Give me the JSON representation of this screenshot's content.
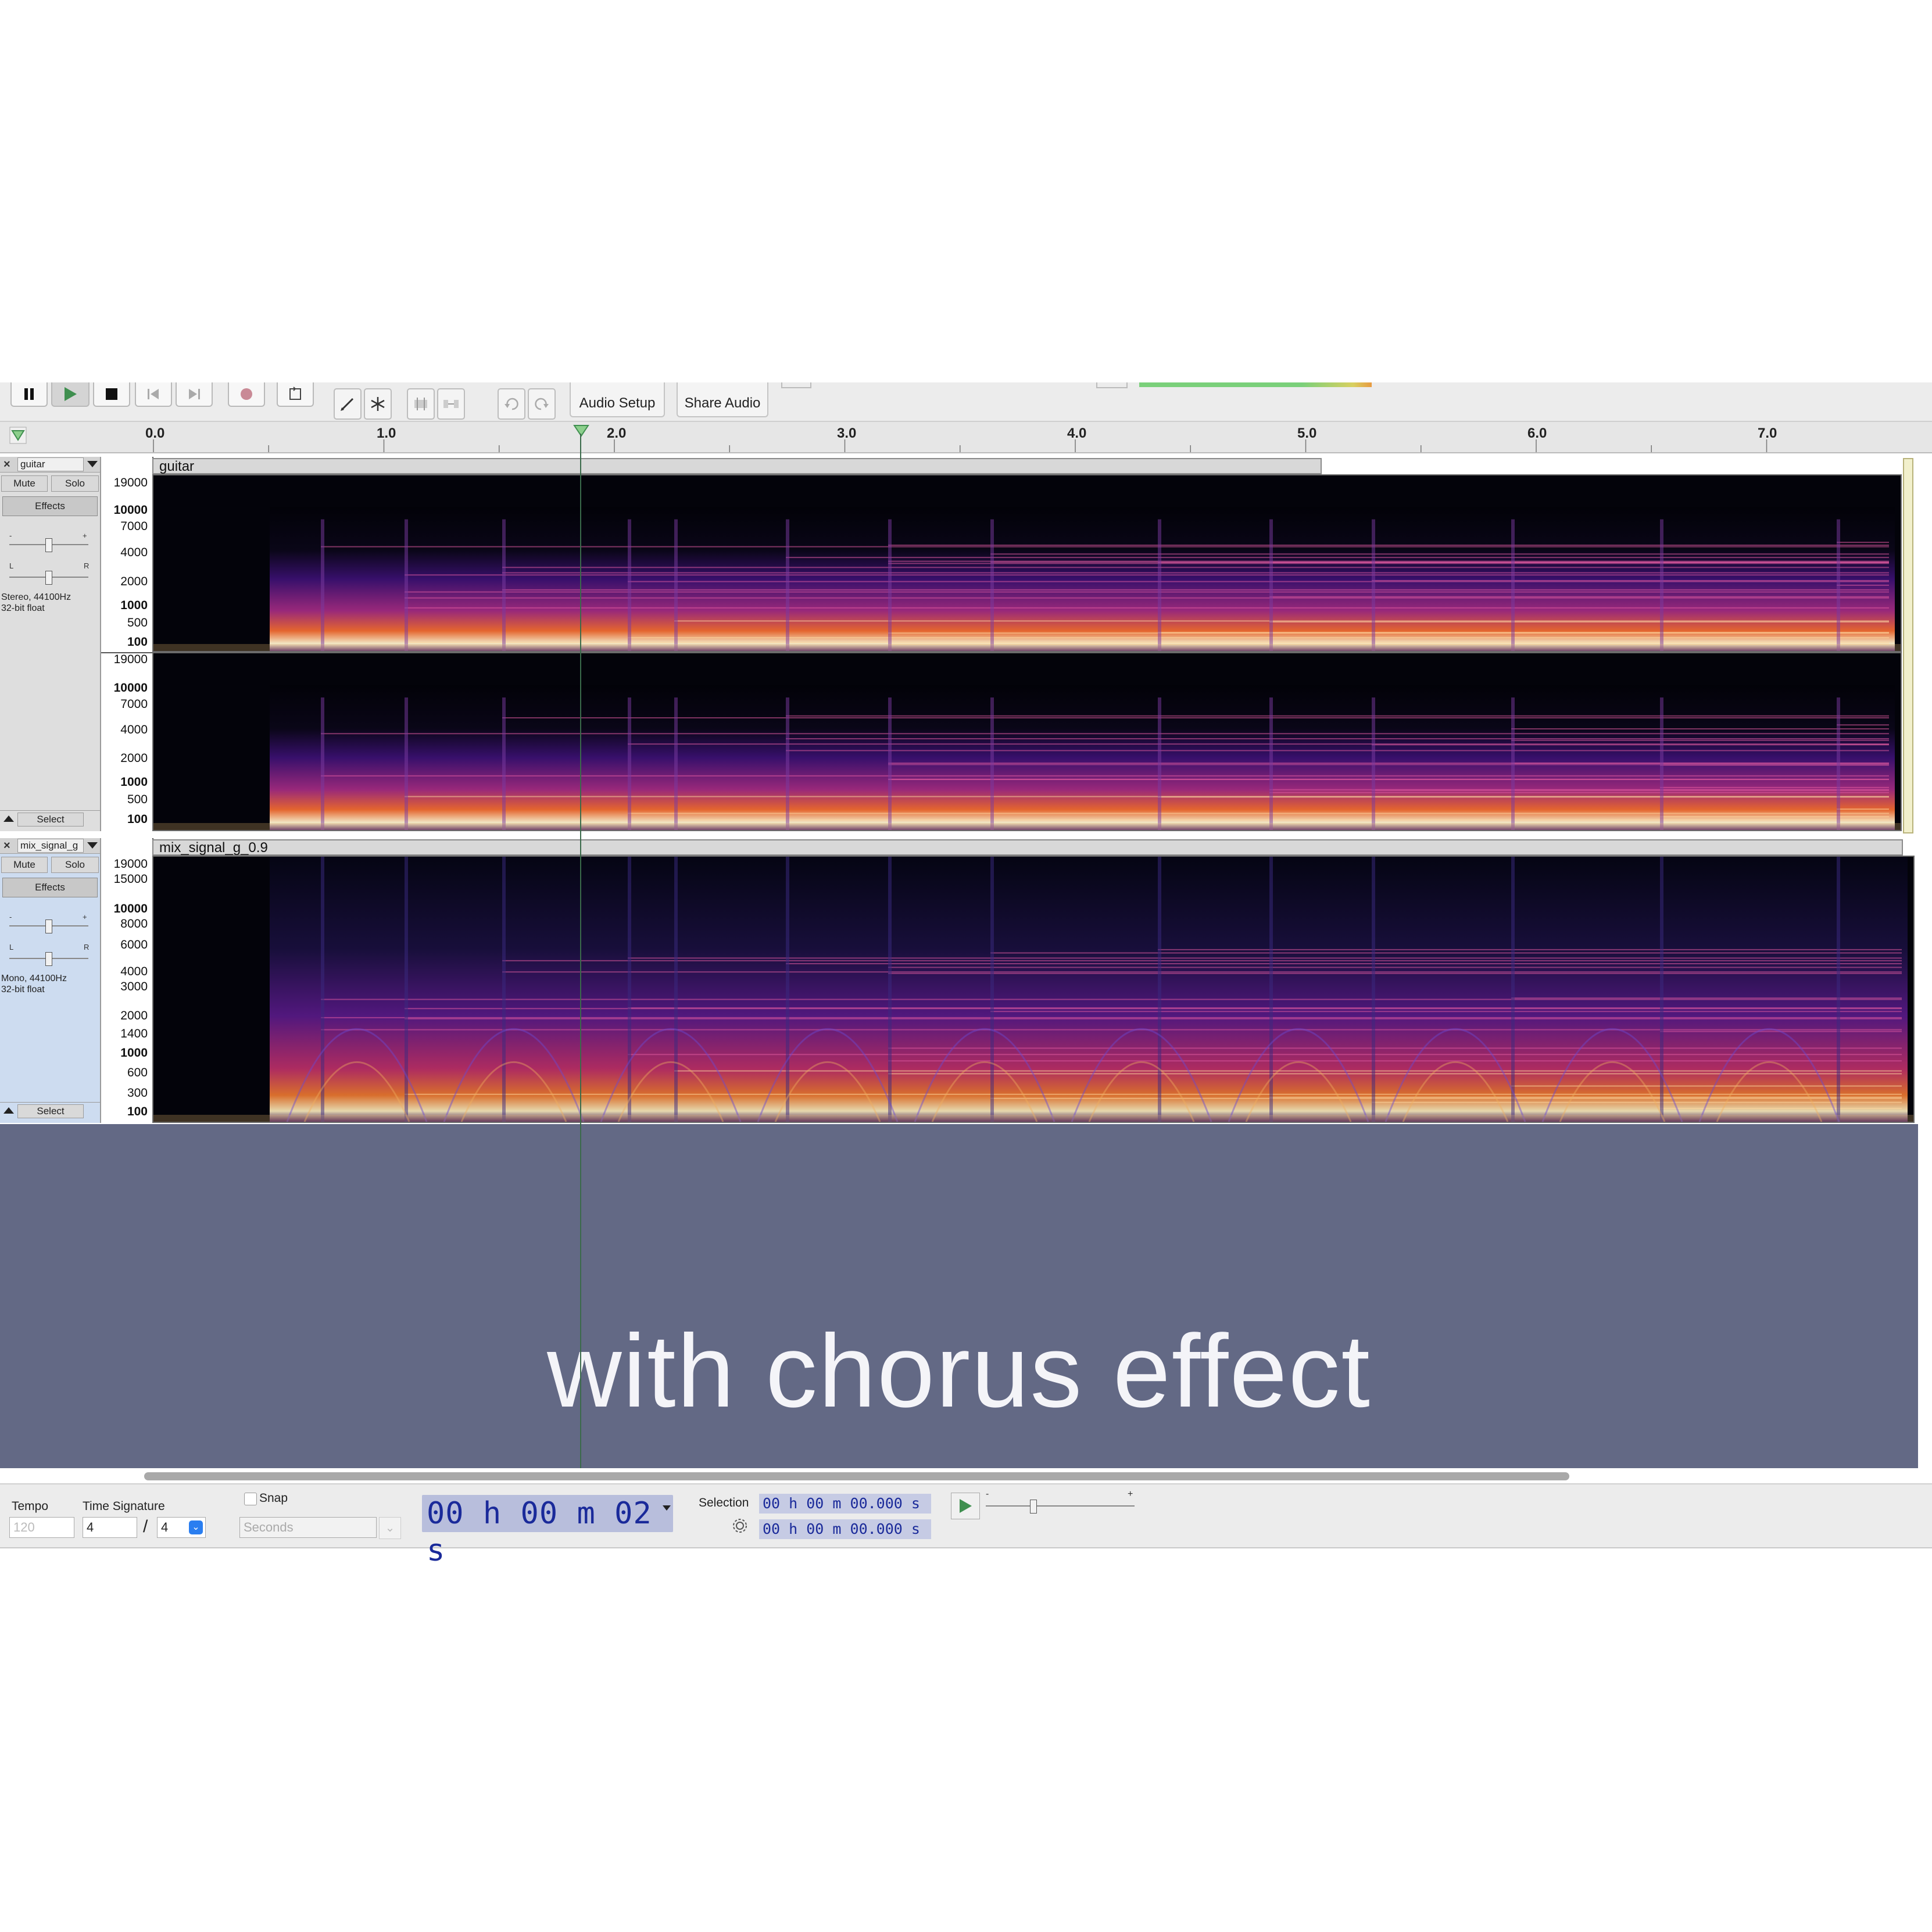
{
  "toolbar": {
    "audio_setup_label": "Audio Setup",
    "share_audio_label": "Share Audio"
  },
  "ruler": {
    "ticks": [
      "0.0",
      "1.0",
      "2.0",
      "3.0",
      "4.0",
      "5.0",
      "6.0",
      "7.0"
    ]
  },
  "tracks": [
    {
      "name": "guitar",
      "clip_name": "guitar",
      "mute_label": "Mute",
      "solo_label": "Solo",
      "effects_label": "Effects",
      "gain_minus": "-",
      "gain_plus": "+",
      "pan_left": "L",
      "pan_right": "R",
      "info_line1": "Stereo, 44100Hz",
      "info_line2": "32-bit float",
      "select_label": "Select",
      "freq_labels_ch1": [
        "19000",
        "10000",
        "7000",
        "4000",
        "2000",
        "1000",
        "500",
        "100"
      ],
      "freq_labels_ch2": [
        "19000",
        "10000",
        "7000",
        "4000",
        "2000",
        "1000",
        "500",
        "100"
      ]
    },
    {
      "name": "mix_signal_g",
      "clip_name": "mix_signal_g_0.9",
      "mute_label": "Mute",
      "solo_label": "Solo",
      "effects_label": "Effects",
      "gain_minus": "-",
      "gain_plus": "+",
      "pan_left": "L",
      "pan_right": "R",
      "info_line1": "Mono, 44100Hz",
      "info_line2": "32-bit float",
      "select_label": "Select",
      "freq_labels_ch1": [
        "19000",
        "15000",
        "10000",
        "8000",
        "6000",
        "4000",
        "3000",
        "2000",
        "1400",
        "1000",
        "600",
        "300",
        "100"
      ]
    }
  ],
  "caption": "with chorus effect",
  "status": {
    "tempo_label": "Tempo",
    "tempo_value": "120",
    "time_sig_label": "Time Signature",
    "time_sig_num": "4",
    "time_sig_slash": "/",
    "time_sig_den": "4",
    "snap_label": "Snap",
    "snap_unit": "Seconds",
    "time_display": "00 h 00 m 02 s",
    "selection_label": "Selection",
    "selection_start": "00 h 00 m 00.000 s",
    "selection_end": "00 h 00 m 00.000 s",
    "speed_minus": "-",
    "speed_plus": "+"
  },
  "colors": {
    "accent_play": "#3f8f4f",
    "empty_area": "#636985",
    "time_text": "#1a2a9a"
  }
}
